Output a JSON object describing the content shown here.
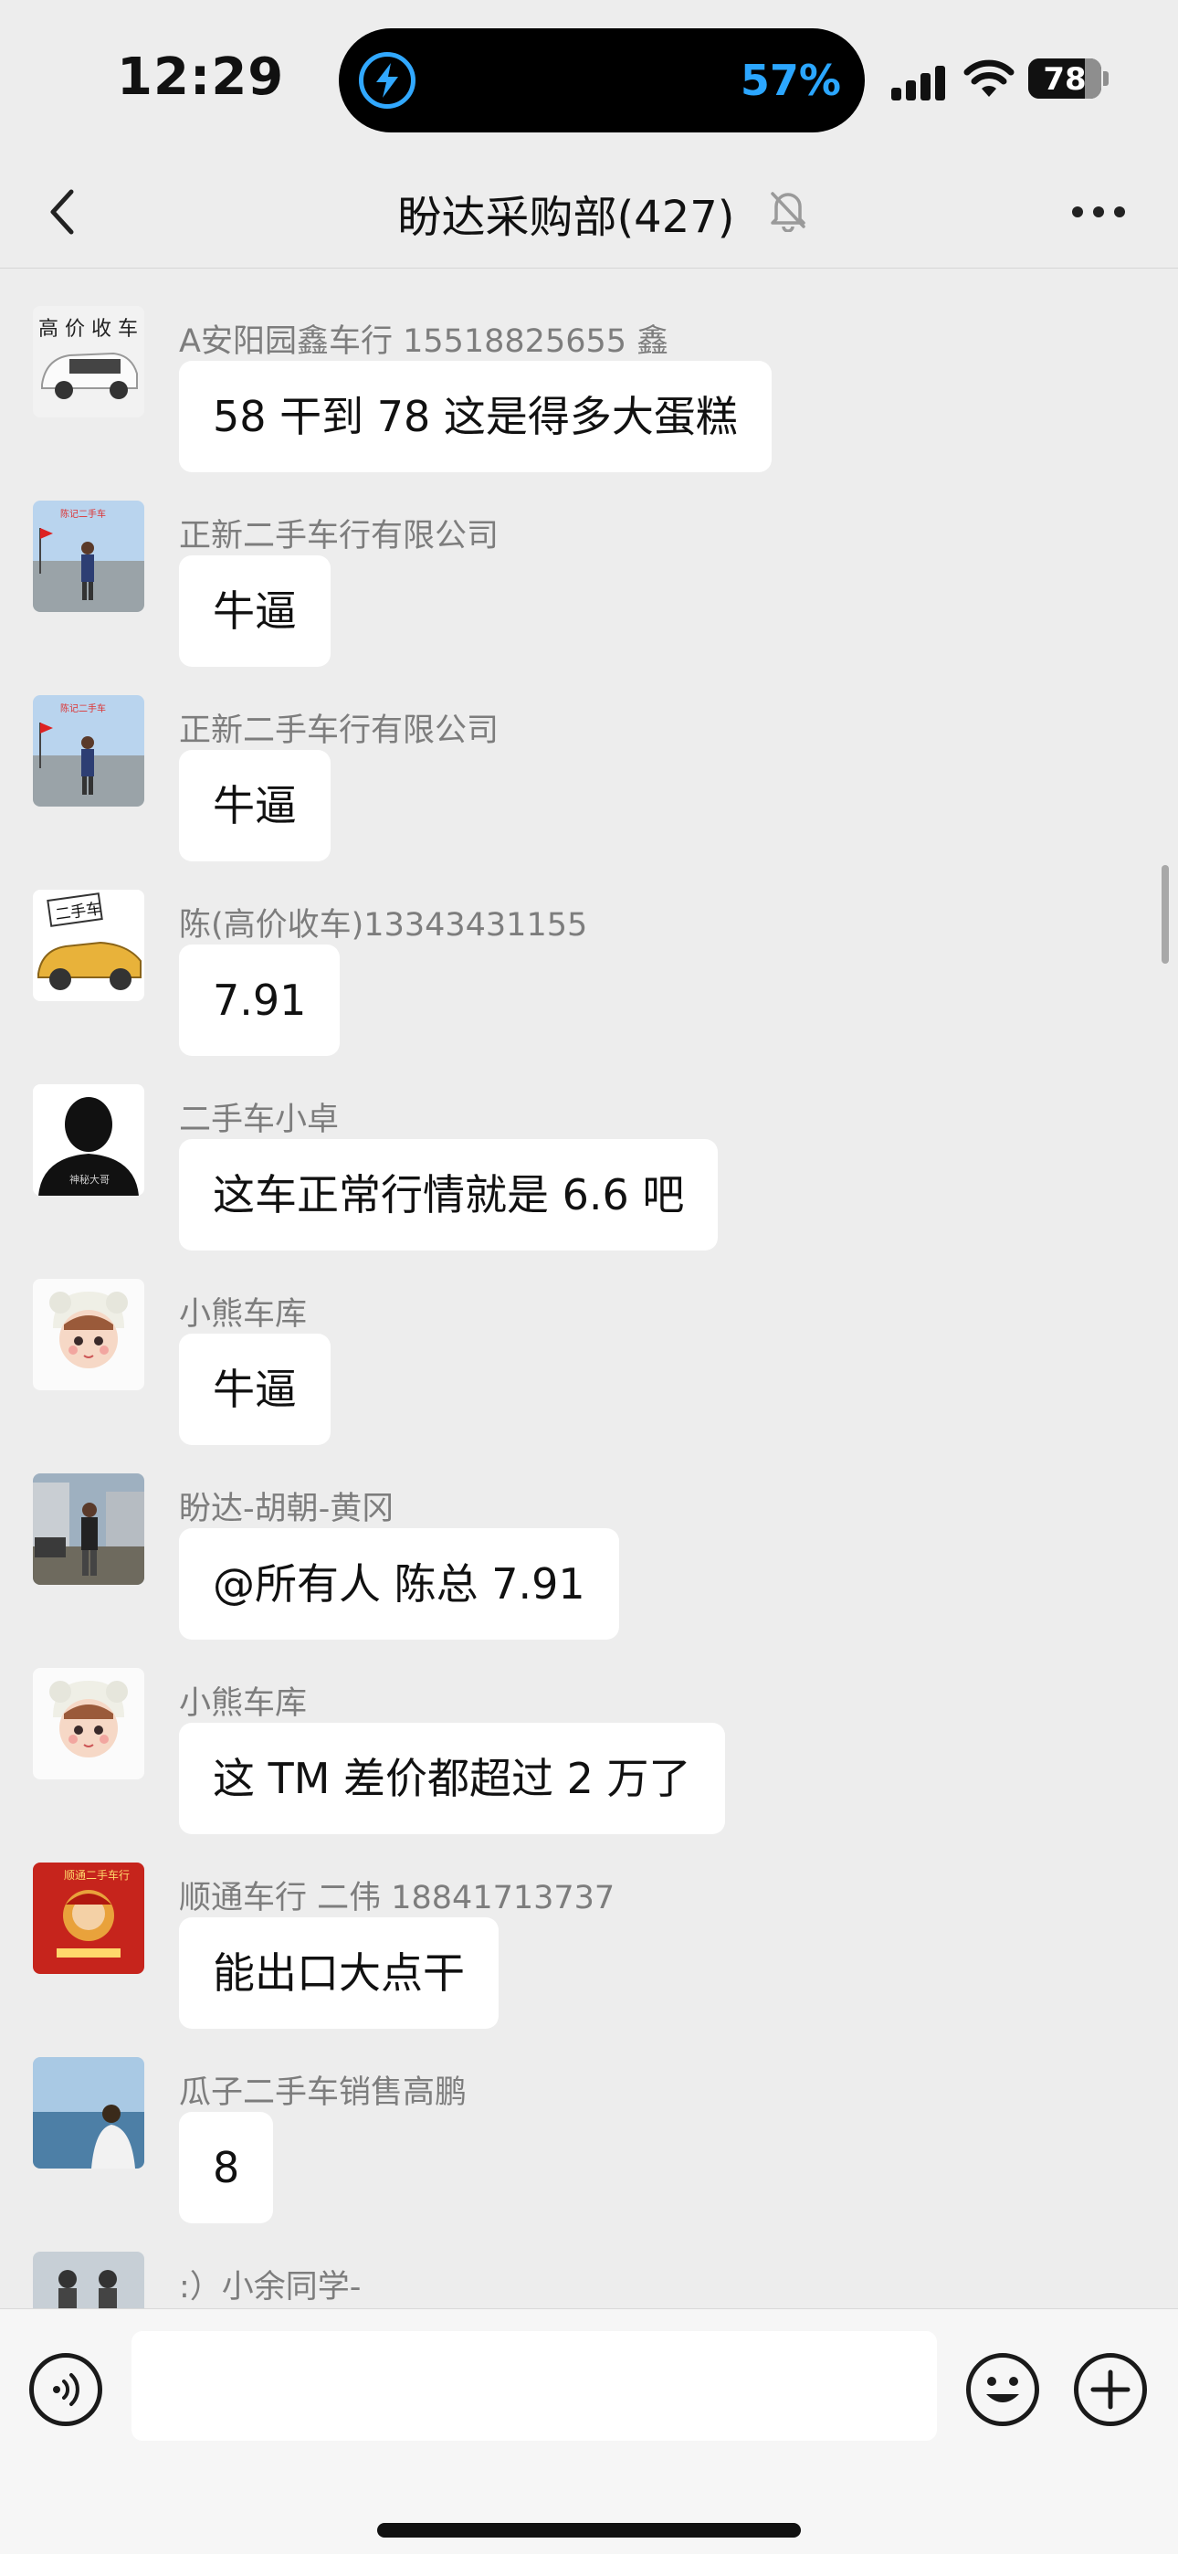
{
  "status_bar": {
    "time": "12:29",
    "island_battery": "57%",
    "battery_level": "78",
    "battery_fraction": 0.78,
    "signal_icon": "cellular-signal-icon",
    "wifi_icon": "wifi-icon",
    "charging_icon": "lightning-bolt-icon",
    "accent_color": "#2ba6ff"
  },
  "nav": {
    "back_icon": "chevron-left-icon",
    "title": "盼达采购部(427)",
    "mute_icon": "bell-slash-icon",
    "more_icon": "ellipsis-icon"
  },
  "messages": [
    {
      "sender": "A安阳园鑫车行 15518825655 鑫",
      "text": "58 干到 78 这是得多大蛋糕",
      "avatar": "white-minivan-avatar"
    },
    {
      "sender": "正新二手车行有限公司",
      "text": "牛逼",
      "avatar": "man-by-sea-avatar"
    },
    {
      "sender": "正新二手车行有限公司",
      "text": "牛逼",
      "avatar": "man-by-sea-avatar"
    },
    {
      "sender": "陈(高价收车)13343431155",
      "text": "7.91",
      "avatar": "yellow-car-avatar"
    },
    {
      "sender": "二手车小卓",
      "text": "这车正常行情就是 6.6 吧",
      "avatar": "silhouette-avatar"
    },
    {
      "sender": "小熊车库",
      "text": "牛逼",
      "avatar": "baby-cartoon-avatar"
    },
    {
      "sender": "盼达-胡朝-黄冈",
      "text": "@所有人 陈总 7.91",
      "avatar": "man-outdoor-avatar"
    },
    {
      "sender": "小熊车库",
      "text": "这 TM 差价都超过 2 万了",
      "avatar": "baby-cartoon-avatar"
    },
    {
      "sender": "顺通车行 二伟 18841713737",
      "text": "能出口大点干",
      "avatar": "red-poster-avatar"
    },
    {
      "sender": "瓜子二手车销售高鹏",
      "text": "8",
      "avatar": "person-by-sea-avatar"
    },
    {
      "sender": ":）小余同学-",
      "text": "",
      "avatar": "couple-beach-avatar"
    }
  ],
  "input_bar": {
    "voice_icon": "voice-wave-icon",
    "placeholder": "",
    "emoji_icon": "smiley-face-icon",
    "add_icon": "plus-circle-icon"
  }
}
